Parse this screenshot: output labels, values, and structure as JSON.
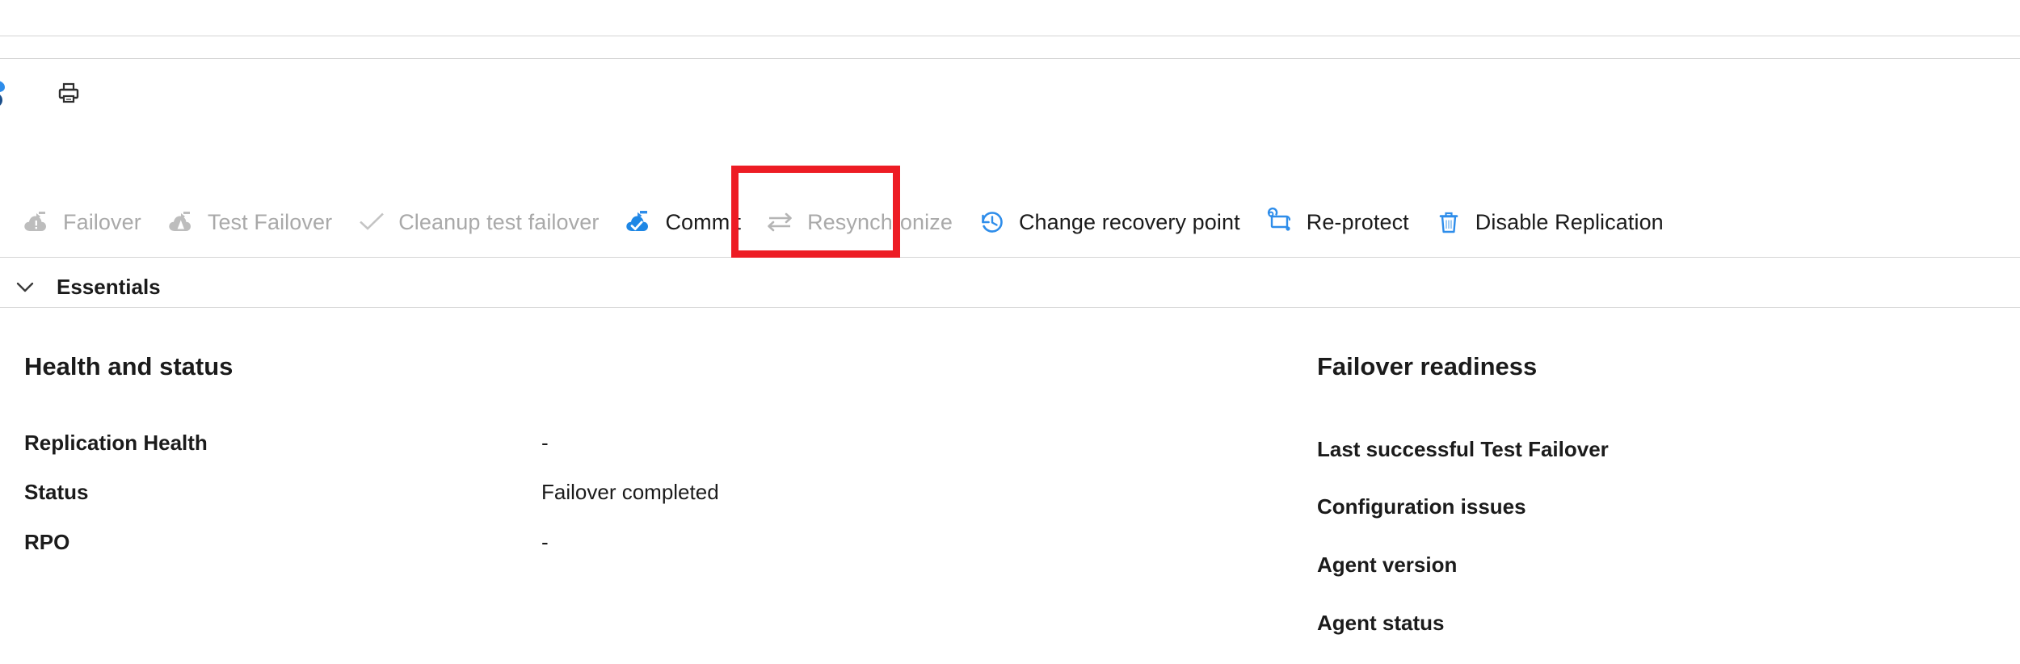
{
  "toolbar": {
    "actions": [
      {
        "id": "failover",
        "label": "Failover",
        "icon": "cloud-failover-icon",
        "enabled": false
      },
      {
        "id": "test-failover",
        "label": "Test Failover",
        "icon": "cloud-test-failover-icon",
        "enabled": false
      },
      {
        "id": "cleanup-test-failover",
        "label": "Cleanup test failover",
        "icon": "checkmark-icon",
        "enabled": false
      },
      {
        "id": "commit",
        "label": "Commit",
        "icon": "cloud-commit-check-icon",
        "enabled": true
      },
      {
        "id": "resynchronize",
        "label": "Resynchronize",
        "icon": "two-way-arrows-icon",
        "enabled": false
      },
      {
        "id": "change-recovery-point",
        "label": "Change recovery point",
        "icon": "clock-history-icon",
        "enabled": true
      },
      {
        "id": "re-protect",
        "label": "Re-protect",
        "icon": "reprotect-icon",
        "enabled": true
      },
      {
        "id": "disable-replication",
        "label": "Disable Replication",
        "icon": "trash-icon",
        "enabled": true
      }
    ]
  },
  "command_bar": {
    "print_icon": "printer-icon",
    "edge_icon": "clipped-icon"
  },
  "essentials": {
    "label": "Essentials",
    "chevron_icon": "chevron-down-icon",
    "expanded": true
  },
  "health_and_status": {
    "title": "Health and status",
    "rows": [
      {
        "key": "Replication Health",
        "value": "-"
      },
      {
        "key": "Status",
        "value": "Failover completed"
      },
      {
        "key": "RPO",
        "value": "-"
      }
    ]
  },
  "failover_readiness": {
    "title": "Failover readiness",
    "rows": [
      {
        "key": "Last successful Test Failover",
        "value": ""
      },
      {
        "key": "Configuration issues",
        "value": ""
      },
      {
        "key": "Agent version",
        "value": ""
      },
      {
        "key": "Agent status",
        "value": ""
      }
    ]
  },
  "annotation": {
    "highlight_target": "commit",
    "color": "#ed1c24"
  },
  "colors": {
    "accent_blue": "#0078d4",
    "icon_blue": "#2e8dea",
    "disabled_grey": "#a9a9a9",
    "text": "#1b1b1b",
    "divider": "#d4d4d4",
    "highlight_red": "#ed1c24"
  }
}
